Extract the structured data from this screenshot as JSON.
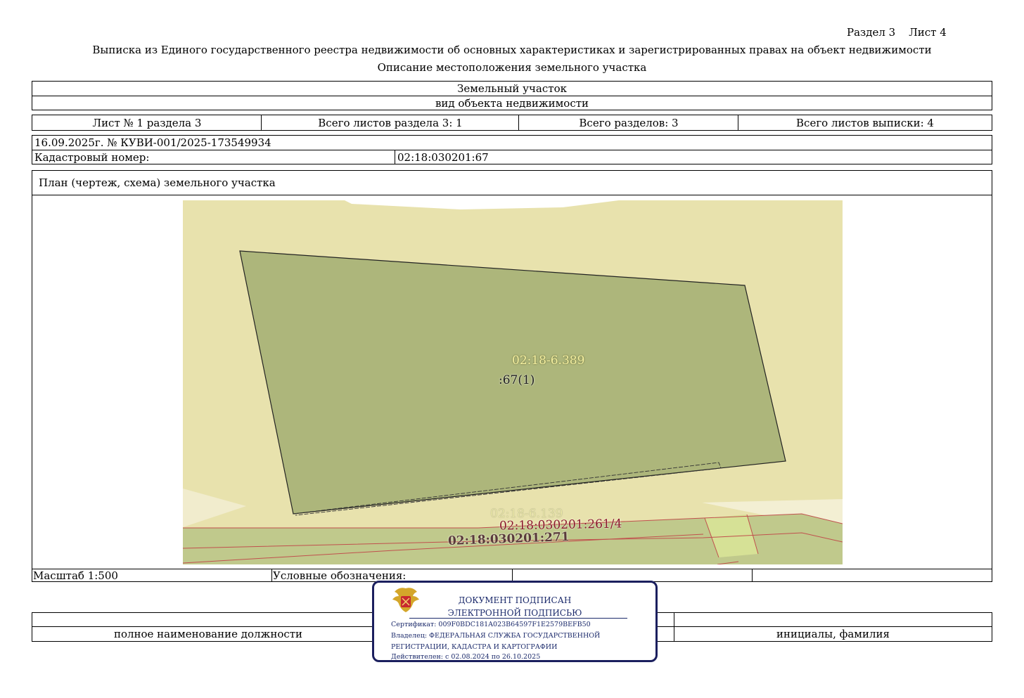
{
  "header": {
    "section_sheet": "Раздел 3    Лист 4",
    "title": "Выписка из Единого государственного реестра недвижимости об основных характеристиках и зарегистрированных правах на объект недвижимости",
    "subtitle": "Описание местоположения земельного участка"
  },
  "object": {
    "type_value": "Земельный участок",
    "type_caption": "вид объекта недвижимости"
  },
  "sheets": {
    "sheet_no": "Лист № 1 раздела 3",
    "total_sheets_section": "Всего листов раздела 3: 1",
    "total_sections": "Всего разделов: 3",
    "total_sheets": "Всего листов выписки: 4"
  },
  "info": {
    "date_number": "16.09.2025г. № КУВИ-001/2025-173549934",
    "cadastral_label": "Кадастровый номер:",
    "cadastral_value": "02:18:030201:67"
  },
  "plan": {
    "title": "План (чертеж, схема) земельного участка",
    "labels": {
      "zone_top": "02:18-6.389",
      "parcel": ":67(1)",
      "zone_bottom": "02:18-6.139",
      "neighbor1": "02:18:030201:261/4",
      "neighbor2": "02:18:030201:271"
    },
    "colors": {
      "background_zone": "#e8e2ad",
      "parcel_fill": "#adb67b",
      "road_fill": "#c0c98c",
      "boundary_red": "#c0504d"
    }
  },
  "footer": {
    "scale": "Масштаб 1:500",
    "legend_label": "Условные обозначения:",
    "position_caption": "полное наименование должности",
    "initials_caption": "инициалы, фамилия"
  },
  "stamp": {
    "line1": "ДОКУМЕНТ ПОДПИСАН",
    "line2": "ЭЛЕКТРОННОЙ ПОДПИСЬЮ",
    "certificate": "Сертификат: 009F0BDC181A023B64597F1E2579BEFB50",
    "owner1": "Владелец: ФЕДЕРАЛЬНАЯ СЛУЖБА ГОСУДАРСТВЕННОЙ",
    "owner2": "РЕГИСТРАЦИИ, КАДАСТРА И КАРТОГРАФИИ",
    "valid": "Действителен: с 02.08.2024 по 26.10.2025"
  }
}
